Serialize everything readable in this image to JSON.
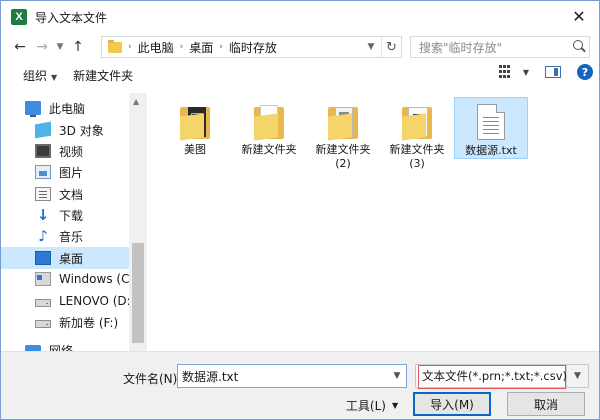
{
  "window": {
    "title": "导入文本文件",
    "app_icon_letter": "X"
  },
  "nav": {
    "breadcrumb": [
      "此电脑",
      "桌面",
      "临时存放"
    ],
    "search_placeholder": "搜索\"临时存放\""
  },
  "toolbar": {
    "organize": "组织",
    "new_folder": "新建文件夹"
  },
  "sidebar": {
    "items": [
      {
        "label": "此电脑",
        "icon": "computer-icon"
      },
      {
        "label": "3D 对象",
        "icon": "3d-objects-icon"
      },
      {
        "label": "视频",
        "icon": "video-icon"
      },
      {
        "label": "图片",
        "icon": "pictures-icon"
      },
      {
        "label": "文档",
        "icon": "documents-icon"
      },
      {
        "label": "下载",
        "icon": "download-icon"
      },
      {
        "label": "音乐",
        "icon": "music-icon"
      },
      {
        "label": "桌面",
        "icon": "desktop-icon",
        "selected": true
      },
      {
        "label": "Windows (C:)",
        "icon": "drive-c-icon"
      },
      {
        "label": "LENOVO (D:)",
        "icon": "drive-icon"
      },
      {
        "label": "新加卷 (F:)",
        "icon": "drive-icon"
      },
      {
        "label": "网络",
        "icon": "network-icon"
      }
    ]
  },
  "files": [
    {
      "name": "美图",
      "kind": "folder"
    },
    {
      "name": "新建文件夹",
      "kind": "folder"
    },
    {
      "name": "新建文件夹",
      "sub": "(2)",
      "kind": "folder"
    },
    {
      "name": "新建文件夹",
      "sub": "(3)",
      "kind": "folder"
    },
    {
      "name": "数据源.txt",
      "kind": "text-file",
      "selected": true
    }
  ],
  "bottom": {
    "filename_label": "文件名(N):",
    "filename_value": "数据源.txt",
    "filetype_value": "文本文件(*.prn;*.txt;*.csv)",
    "tools_label": "工具(L)",
    "import_label": "导入(M)",
    "cancel_label": "取消"
  },
  "colors": {
    "selection": "#cce8ff",
    "accent": "#0a67c4",
    "highlight_box": "#e05858"
  }
}
